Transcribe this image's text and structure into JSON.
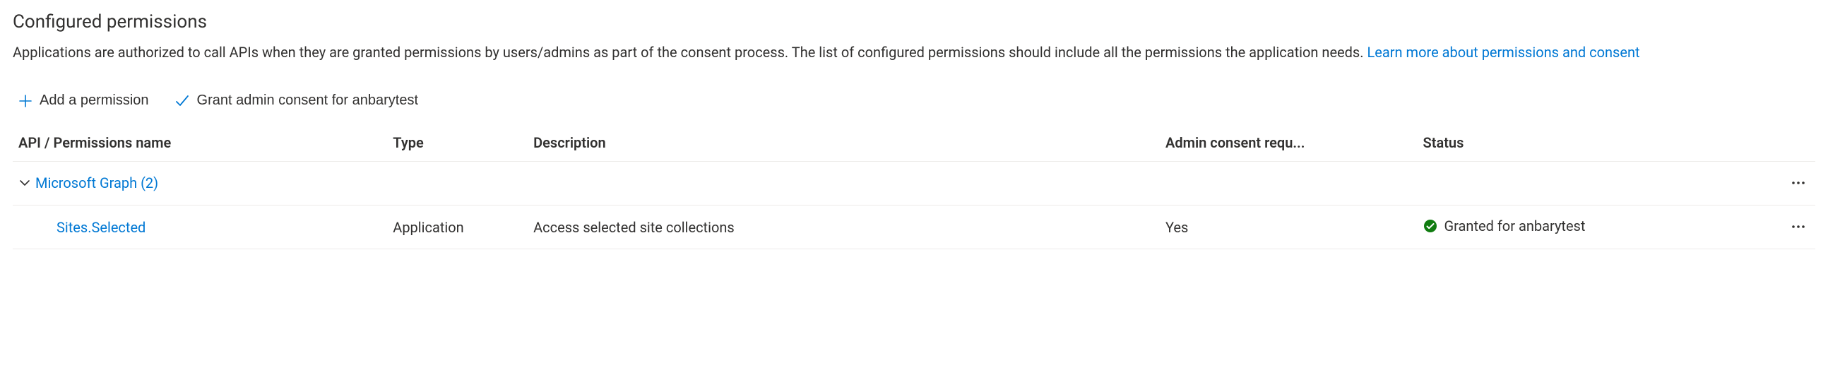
{
  "section": {
    "title": "Configured permissions",
    "description_pre": "Applications are authorized to call APIs when they are granted permissions by users/admins as part of the consent process. The list of configured permissions should include all the permissions the application needs. ",
    "learn_more": "Learn more about permissions and consent"
  },
  "actions": {
    "add_permission": "Add a permission",
    "grant_consent": "Grant admin consent for anbarytest"
  },
  "table": {
    "headers": {
      "name": "API / Permissions name",
      "type": "Type",
      "description": "Description",
      "consent": "Admin consent requ...",
      "status": "Status"
    },
    "api_group": {
      "name": "Microsoft Graph (2)"
    },
    "rows": [
      {
        "name": "Sites.Selected",
        "type": "Application",
        "description": "Access selected site collections",
        "consent": "Yes",
        "status": "Granted for anbarytest"
      }
    ]
  }
}
